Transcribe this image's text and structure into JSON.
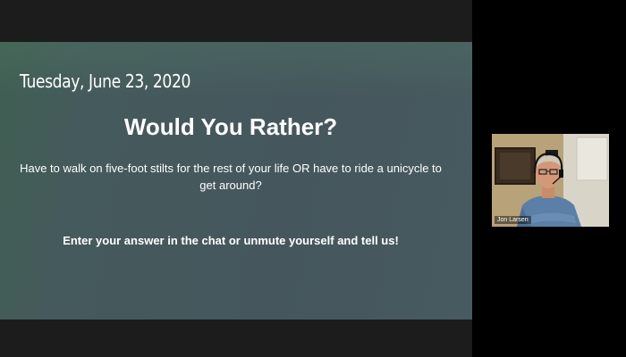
{
  "slide": {
    "date": "Tuesday, June 23, 2020",
    "title": "Would You Rather?",
    "question": "Have to walk on five-foot stilts for the rest of your life OR have to ride a unicycle to get around?",
    "instruction": "Enter your answer in the chat or unmute yourself and tell us!"
  },
  "participant": {
    "name": "Jon Larsen",
    "video_icon": "person-video-icon"
  },
  "colors": {
    "background": "#000000",
    "slide": "#45575d",
    "text": "#ffffff"
  }
}
